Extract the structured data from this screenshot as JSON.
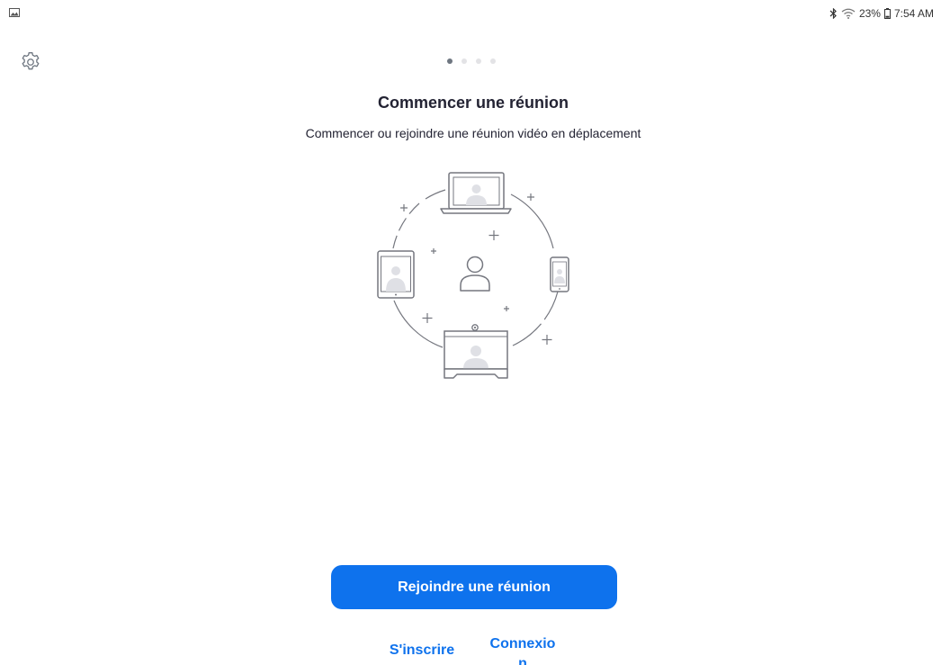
{
  "status_bar": {
    "left_icon": "image-notification-icon",
    "bluetooth_icon": "bluetooth-icon",
    "wifi_icon": "wifi-icon",
    "battery_percent": "23%",
    "battery_icon": "battery-icon",
    "time": "7:54 AM"
  },
  "header": {
    "settings_icon": "gear-icon"
  },
  "carousel": {
    "pages": 4,
    "active_index": 0,
    "title": "Commencer une réunion",
    "subtitle": "Commencer ou rejoindre une réunion vidéo en déplacement",
    "illustration": "devices-circle-meeting-illustration"
  },
  "actions": {
    "join_label": "Rejoindre une réunion",
    "signup_label": "S'inscrire",
    "login_label": "Connexion"
  },
  "colors": {
    "accent": "#0e72ed",
    "text": "#232333",
    "dot_active": "#6e7680",
    "dot_inactive": "#e3e3e6",
    "illustration_stroke": "#75777f",
    "illustration_fill": "#dfe0e5"
  }
}
